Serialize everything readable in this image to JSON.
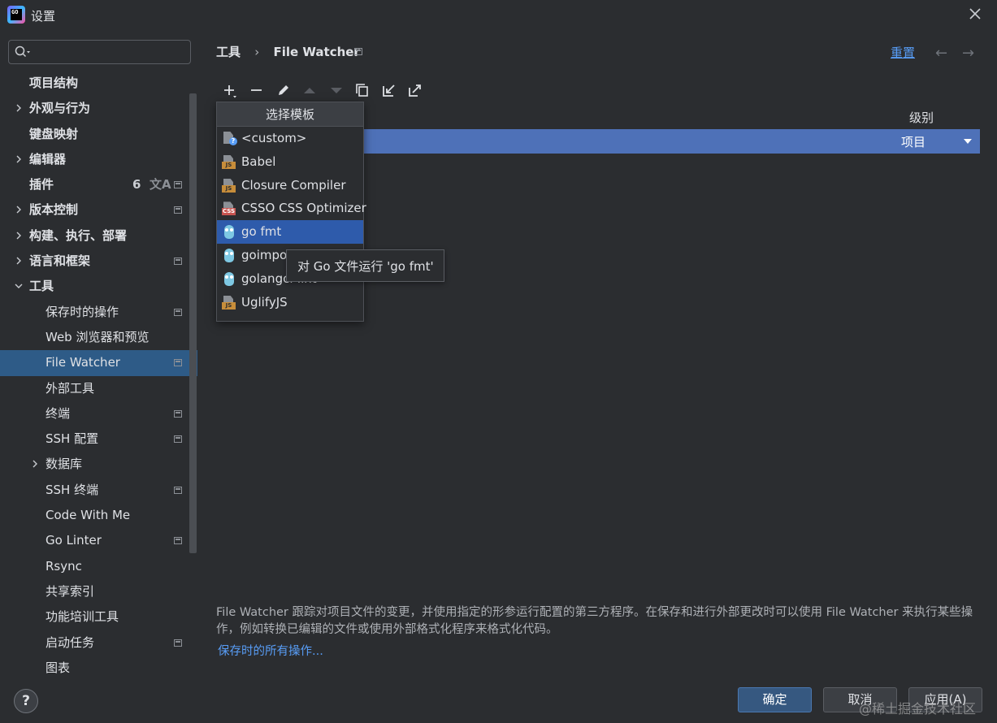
{
  "window": {
    "title": "设置"
  },
  "search": {
    "placeholder": ""
  },
  "sidebar": {
    "items": [
      {
        "label": "项目结构",
        "level": 0,
        "bold": true
      },
      {
        "label": "外观与行为",
        "level": 0,
        "bold": true,
        "expandable": true
      },
      {
        "label": "键盘映射",
        "level": 0,
        "bold": true
      },
      {
        "label": "编辑器",
        "level": 0,
        "bold": true,
        "expandable": true
      },
      {
        "label": "插件",
        "level": 0,
        "bold": true,
        "count": "6"
      },
      {
        "label": "版本控制",
        "level": 0,
        "bold": true,
        "expandable": true
      },
      {
        "label": "构建、执行、部署",
        "level": 0,
        "bold": true,
        "expandable": true
      },
      {
        "label": "语言和框架",
        "level": 0,
        "bold": true,
        "expandable": true
      },
      {
        "label": "工具",
        "level": 0,
        "bold": true,
        "expanded": true
      },
      {
        "label": "保存时的操作",
        "level": 1
      },
      {
        "label": "Web 浏览器和预览",
        "level": 1
      },
      {
        "label": "File Watcher",
        "level": 1,
        "selected": true
      },
      {
        "label": "外部工具",
        "level": 1
      },
      {
        "label": "终端",
        "level": 1
      },
      {
        "label": "SSH 配置",
        "level": 1
      },
      {
        "label": "数据库",
        "level": 1,
        "expandable": true
      },
      {
        "label": "SSH 终端",
        "level": 1
      },
      {
        "label": "Code With Me",
        "level": 1
      },
      {
        "label": "Go Linter",
        "level": 1
      },
      {
        "label": "Rsync",
        "level": 1
      },
      {
        "label": "共享索引",
        "level": 1
      },
      {
        "label": "功能培训工具",
        "level": 1
      },
      {
        "label": "启动任务",
        "level": 1
      },
      {
        "label": "图表",
        "level": 1
      }
    ]
  },
  "header": {
    "breadcrumb_parent": "工具",
    "breadcrumb_separator": "›",
    "breadcrumb_current": "File Watcher",
    "reset_label": "重置",
    "back_arrow": "←",
    "forward_arrow": "→"
  },
  "table": {
    "level_header": "级别",
    "row_level": "项目"
  },
  "popup": {
    "title": "选择模板",
    "items": [
      {
        "label": "<custom>",
        "icon": "custom-file-icon"
      },
      {
        "label": "Babel",
        "icon": "js-file-icon",
        "tag": "JS"
      },
      {
        "label": "Closure Compiler",
        "icon": "js-file-icon",
        "tag": "JS"
      },
      {
        "label": "CSSO CSS Optimizer",
        "icon": "css-file-icon",
        "tag": "CSS"
      },
      {
        "label": "go fmt",
        "icon": "gopher-icon",
        "selected": true
      },
      {
        "label": "goimports",
        "icon": "gopher-icon"
      },
      {
        "label": "golangci-lint",
        "icon": "gopher-icon"
      },
      {
        "label": "UglifyJS",
        "icon": "js-file-icon",
        "tag": "JS"
      }
    ]
  },
  "tooltip": {
    "text": "对 Go 文件运行 'go fmt'"
  },
  "description": {
    "text": "File Watcher 跟踪对项目文件的变更，并使用指定的形参运行配置的第三方程序。在保存和进行外部更改时可以使用 File Watcher 来执行某些操作，例如转换已编辑的文件或使用外部格式化程序来格式化代码。",
    "link": "保存时的所有操作..."
  },
  "footer": {
    "help": "?",
    "ok": "确定",
    "cancel": "取消",
    "apply": "应用(A)"
  },
  "watermark": "@稀土掘金技术社区",
  "colors": {
    "background": "#2b2d30",
    "selection": "#2e5b87",
    "row_selection": "#4e71b8",
    "link": "#589df6"
  }
}
